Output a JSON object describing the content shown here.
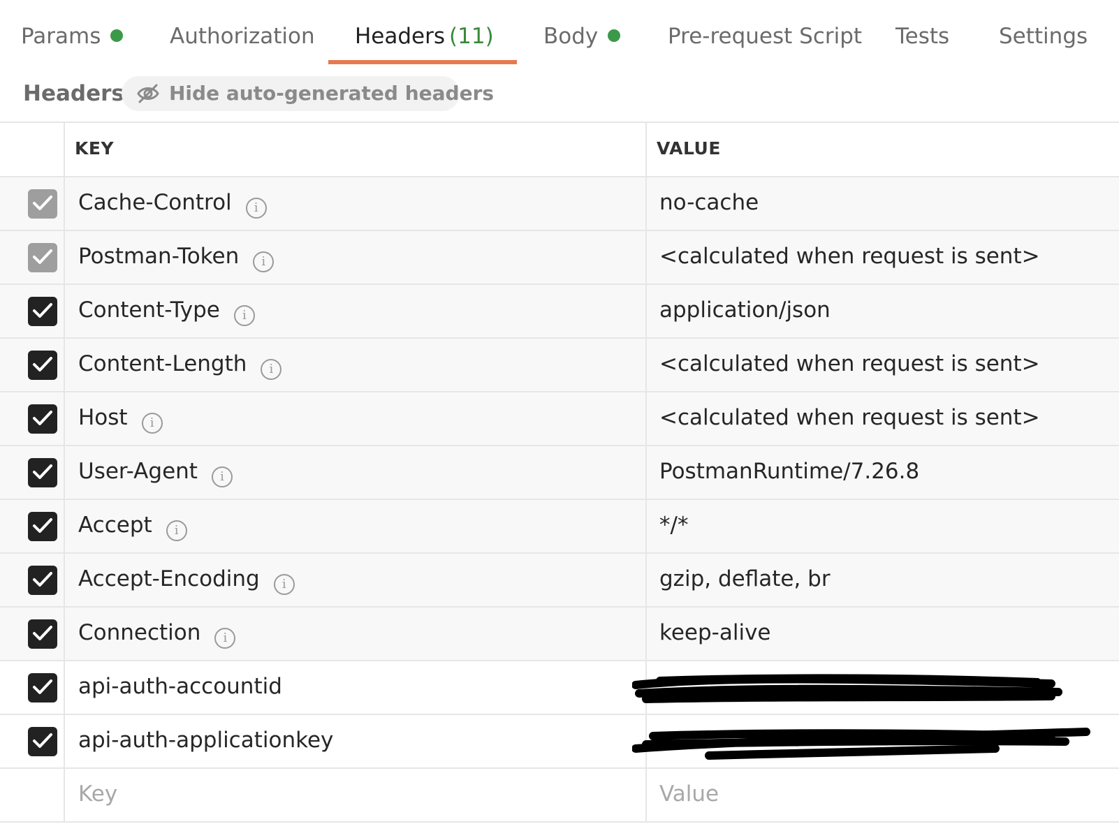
{
  "tabs": [
    {
      "label": "Params",
      "dot": true
    },
    {
      "label": "Authorization",
      "dot": false
    },
    {
      "label": "Headers",
      "count": "(11)",
      "active": true
    },
    {
      "label": "Body",
      "dot": true
    },
    {
      "label": "Pre-request Script",
      "dot": false
    },
    {
      "label": "Tests",
      "dot": false
    },
    {
      "label": "Settings",
      "dot": false
    }
  ],
  "subheader": {
    "title": "Headers",
    "hide_button": "Hide auto-generated headers"
  },
  "table": {
    "key_header": "KEY",
    "value_header": "VALUE",
    "rows": [
      {
        "key": "Cache-Control",
        "value": "no-cache",
        "checked": true,
        "auto": true,
        "info": true
      },
      {
        "key": "Postman-Token",
        "value": "<calculated when request is sent>",
        "checked": true,
        "auto": true,
        "info": true
      },
      {
        "key": "Content-Type",
        "value": "application/json",
        "checked": true,
        "auto": false,
        "info": true
      },
      {
        "key": "Content-Length",
        "value": "<calculated when request is sent>",
        "checked": true,
        "auto": false,
        "info": true
      },
      {
        "key": "Host",
        "value": "<calculated when request is sent>",
        "checked": true,
        "auto": false,
        "info": true
      },
      {
        "key": "User-Agent",
        "value": "PostmanRuntime/7.26.8",
        "checked": true,
        "auto": false,
        "info": true
      },
      {
        "key": "Accept",
        "value": "*/*",
        "checked": true,
        "auto": false,
        "info": true
      },
      {
        "key": "Accept-Encoding",
        "value": "gzip, deflate, br",
        "checked": true,
        "auto": false,
        "info": true
      },
      {
        "key": "Connection",
        "value": "keep-alive",
        "checked": true,
        "auto": false,
        "info": true
      },
      {
        "key": "api-auth-accountid",
        "value": "",
        "checked": true,
        "auto": false,
        "info": false,
        "redacted": true
      },
      {
        "key": "api-auth-applicationkey",
        "value": "",
        "checked": true,
        "auto": false,
        "info": false,
        "redacted": true
      }
    ],
    "new_row": {
      "key_placeholder": "Key",
      "value_placeholder": "Value"
    }
  },
  "colors": {
    "active_underline": "#e8784f",
    "status_dot": "#3a9a4a",
    "checkbox": "#222222",
    "checkbox_muted": "#9e9e9e"
  }
}
